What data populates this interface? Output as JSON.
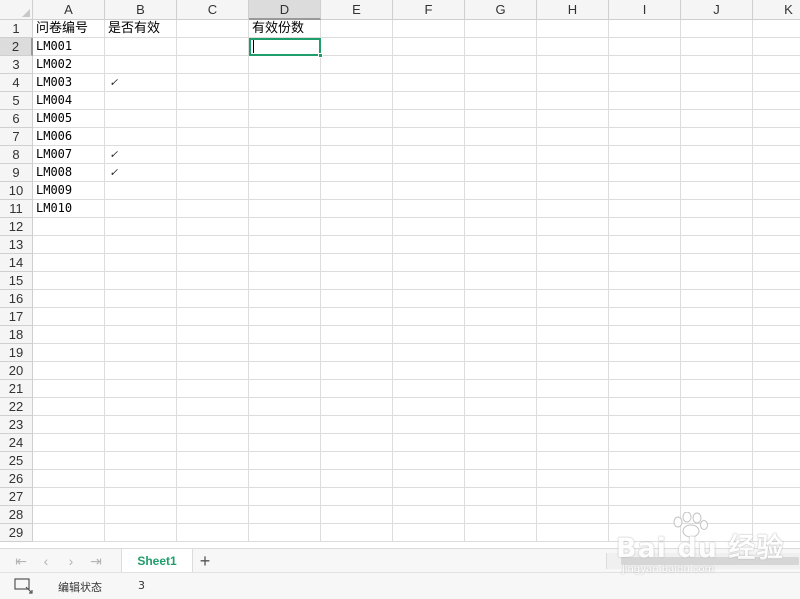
{
  "columns": [
    "A",
    "B",
    "C",
    "D",
    "E",
    "F",
    "G",
    "H",
    "I",
    "J",
    "K"
  ],
  "rows": [
    "1",
    "2",
    "3",
    "4",
    "5",
    "6",
    "7",
    "8",
    "9",
    "10",
    "11",
    "12",
    "13",
    "14",
    "15",
    "16",
    "17",
    "18",
    "19",
    "20",
    "21",
    "22",
    "23",
    "24",
    "25",
    "26",
    "27",
    "28",
    "29"
  ],
  "active_cell": {
    "column": "D",
    "row": "2"
  },
  "cells": {
    "A1": "问卷编号",
    "B1": "是否有效",
    "D1": "有效份数",
    "A2": "LM001",
    "A3": "LM002",
    "A4": "LM003",
    "B4": "✓",
    "A5": "LM004",
    "A6": "LM005",
    "A7": "LM006",
    "A8": "LM007",
    "B8": "✓",
    "A9": "LM008",
    "B9": "✓",
    "A10": "LM009",
    "A11": "LM010"
  },
  "sheet_tabs": [
    {
      "label": "Sheet1",
      "active": true
    }
  ],
  "status": {
    "mode": "编辑状态",
    "count": "3"
  },
  "watermark": {
    "brand": "Bai du 经验",
    "url": "jingyan.baidu.com"
  },
  "colors": {
    "accent": "#1f9d6b",
    "gridline": "#dcdcdc",
    "header_bg": "#f5f5f5"
  }
}
